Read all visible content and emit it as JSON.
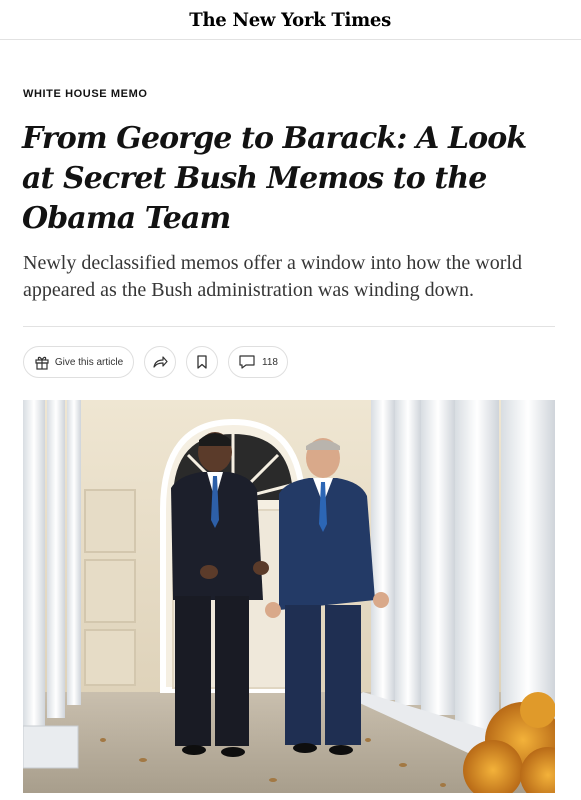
{
  "masthead": {
    "logo_text": "The New York Times"
  },
  "article": {
    "kicker": "WHITE HOUSE MEMO",
    "headline": "From George to Barack: A Look at Secret Bush Memos to the Obama Team",
    "summary": "Newly declassified memos offer a window into how the world appeared as the Bush administration was winding down."
  },
  "share_bar": {
    "gift_label": "Give this article",
    "comment_count": "118",
    "icons": [
      "gift-icon",
      "share-icon",
      "bookmark-icon",
      "comment-icon"
    ]
  },
  "photo": {
    "subject": "lead-photo"
  }
}
